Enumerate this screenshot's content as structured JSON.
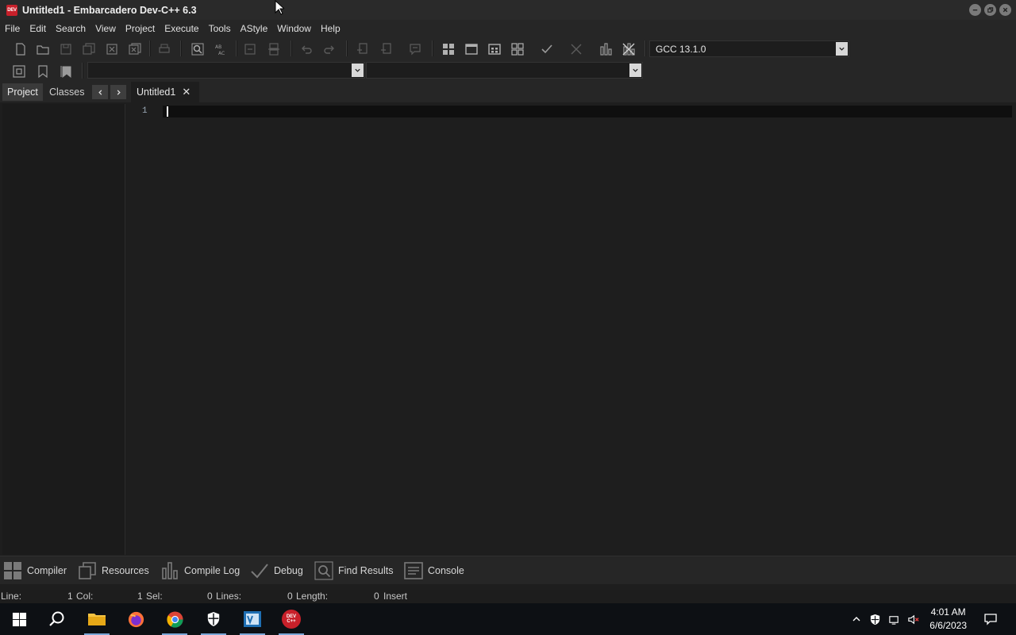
{
  "window": {
    "title": "Untitled1 - Embarcadero Dev-C++ 6.3",
    "app_icon_text": "DEV"
  },
  "menu": [
    "File",
    "Edit",
    "Search",
    "View",
    "Project",
    "Execute",
    "Tools",
    "AStyle",
    "Window",
    "Help"
  ],
  "toolbar": {
    "compiler_select": "GCC 13.1.0",
    "class_select": "",
    "member_select": ""
  },
  "left_panel": {
    "tabs": [
      "Project",
      "Classes"
    ],
    "active_tab": "Project"
  },
  "editor": {
    "tab_label": "Untitled1",
    "tab_close": "✕",
    "line_numbers": [
      "1"
    ],
    "content": ""
  },
  "bottom_tabs": [
    "Compiler",
    "Resources",
    "Compile Log",
    "Debug",
    "Find Results",
    "Console"
  ],
  "status": {
    "line_label": "Line:",
    "line_value": "1",
    "col_label": "Col:",
    "col_value": "1",
    "sel_label": "Sel:",
    "sel_value": "0",
    "lines_label": "Lines:",
    "lines_value": "0",
    "length_label": "Length:",
    "length_value": "0",
    "mode": "Insert"
  },
  "taskbar": {
    "time": "4:01 AM",
    "date": "6/6/2023",
    "devcpp_label": "DEV C++"
  },
  "colors": {
    "background": "#1e1e1e",
    "chrome": "#262626",
    "devcpp_red": "#c8202a",
    "taskbar": "#0d1014"
  }
}
